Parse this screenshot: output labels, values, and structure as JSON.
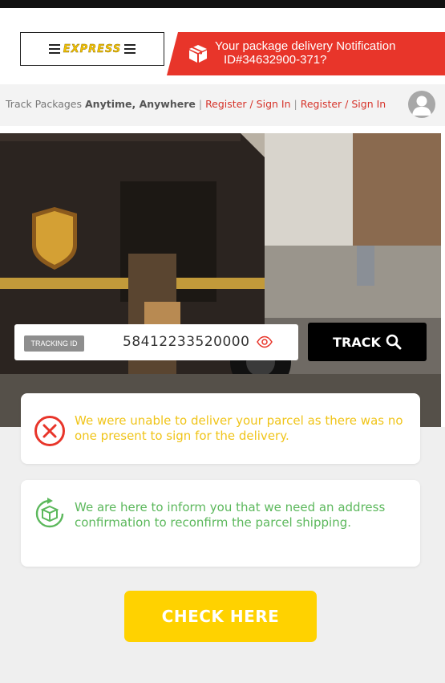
{
  "header": {
    "logo_text": "EXPRESS",
    "notification_line1": "Your package delivery Notification",
    "notification_line2": "ID#34632900-371?"
  },
  "nav": {
    "track_prefix": "Track Packages",
    "track_emphasis": "Anytime, Anywhere",
    "link1": "Register / Sign In",
    "link2": "Register / Sign In"
  },
  "tracking": {
    "badge": "TRACKING ID",
    "value": "58412233520000",
    "button_label": "TRACK"
  },
  "messages": {
    "error": "We were unable to deliver your parcel as there was no one present to sign for the delivery.",
    "info": "We are here to inform you that we need an address confirmation to reconfirm the parcel shipping."
  },
  "cta": {
    "label": "CHECK HERE"
  },
  "colors": {
    "brand_red": "#e8352a",
    "warning_yellow": "#f0c419",
    "success_green": "#5cb85c",
    "cta_yellow": "#ffd200"
  }
}
